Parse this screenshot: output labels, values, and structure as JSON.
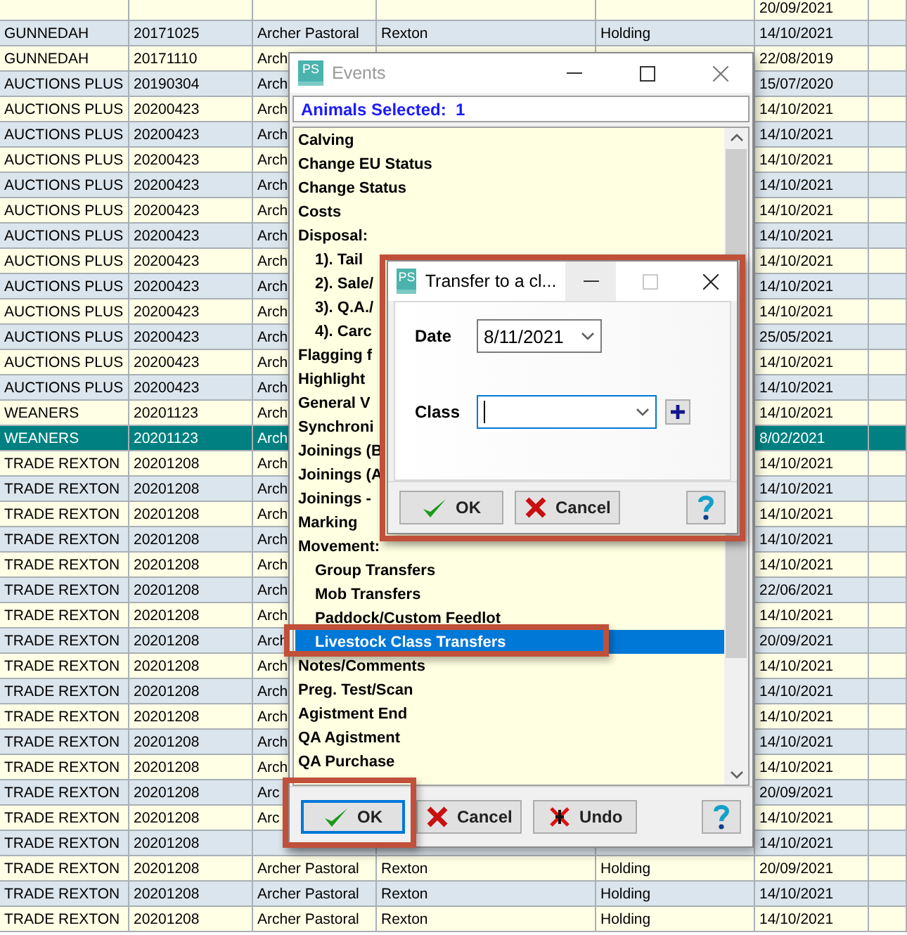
{
  "table": {
    "rows": [
      {
        "column_6": "20/09/2021",
        "selected": false
      },
      {
        "column_1": "GUNNEDAH",
        "column_2": "20171025",
        "column_3": "Archer Pastoral",
        "column_4": "Rexton",
        "column_5": "Holding",
        "column_6": "14/10/2021",
        "selected": false
      },
      {
        "column_1": "GUNNEDAH",
        "column_2": "20171110",
        "column_3": "Arch",
        "column_6": "22/08/2019",
        "selected": false
      },
      {
        "column_1": "AUCTIONS PLUS",
        "column_2": "20190304",
        "column_3": "Arch",
        "column_6": "15/07/2020",
        "selected": false
      },
      {
        "column_1": "AUCTIONS PLUS",
        "column_2": "20200423",
        "column_3": "Arch",
        "column_6": "14/10/2021",
        "selected": false
      },
      {
        "column_1": "AUCTIONS PLUS",
        "column_2": "20200423",
        "column_3": "Arch",
        "column_6": "14/10/2021",
        "selected": false
      },
      {
        "column_1": "AUCTIONS PLUS",
        "column_2": "20200423",
        "column_3": "Arch",
        "column_6": "14/10/2021",
        "selected": false
      },
      {
        "column_1": "AUCTIONS PLUS",
        "column_2": "20200423",
        "column_3": "Arch",
        "column_6": "14/10/2021",
        "selected": false
      },
      {
        "column_1": "AUCTIONS PLUS",
        "column_2": "20200423",
        "column_3": "Arch",
        "column_6": "14/10/2021",
        "selected": false
      },
      {
        "column_1": "AUCTIONS PLUS",
        "column_2": "20200423",
        "column_3": "Arch",
        "column_6": "14/10/2021",
        "selected": false
      },
      {
        "column_1": "AUCTIONS PLUS",
        "column_2": "20200423",
        "column_3": "Arch",
        "column_6": "14/10/2021",
        "selected": false
      },
      {
        "column_1": "AUCTIONS PLUS",
        "column_2": "20200423",
        "column_3": "Arch",
        "column_6": "14/10/2021",
        "selected": false
      },
      {
        "column_1": "AUCTIONS PLUS",
        "column_2": "20200423",
        "column_3": "Arch",
        "column_6": "14/10/2021",
        "selected": false
      },
      {
        "column_1": "AUCTIONS PLUS",
        "column_2": "20200423",
        "column_3": "Arch",
        "column_6": "25/05/2021",
        "selected": false
      },
      {
        "column_1": "AUCTIONS PLUS",
        "column_2": "20200423",
        "column_3": "Arch",
        "column_6": "14/10/2021",
        "selected": false
      },
      {
        "column_1": "AUCTIONS PLUS",
        "column_2": "20200423",
        "column_3": "Arch",
        "column_6": "14/10/2021",
        "selected": false
      },
      {
        "column_1": "WEANERS",
        "column_2": "20201123",
        "column_3": "Arch",
        "column_6": "14/10/2021",
        "selected": false
      },
      {
        "column_1": "WEANERS",
        "column_2": "20201123",
        "column_3": "Arch",
        "column_6": "8/02/2021",
        "selected": true
      },
      {
        "column_1": "TRADE REXTON",
        "column_2": "20201208",
        "column_3": "Arch",
        "column_6": "14/10/2021",
        "selected": false
      },
      {
        "column_1": "TRADE REXTON",
        "column_2": "20201208",
        "column_3": "Arch",
        "column_6": "14/10/2021",
        "selected": false
      },
      {
        "column_1": "TRADE REXTON",
        "column_2": "20201208",
        "column_3": "Arch",
        "column_6": "14/10/2021",
        "selected": false
      },
      {
        "column_1": "TRADE REXTON",
        "column_2": "20201208",
        "column_3": "Arch",
        "column_6": "14/10/2021",
        "selected": false
      },
      {
        "column_1": "TRADE REXTON",
        "column_2": "20201208",
        "column_3": "Arch",
        "column_6": "14/10/2021",
        "selected": false
      },
      {
        "column_1": "TRADE REXTON",
        "column_2": "20201208",
        "column_3": "Arch",
        "column_6": "22/06/2021",
        "selected": false
      },
      {
        "column_1": "TRADE REXTON",
        "column_2": "20201208",
        "column_3": "Arch",
        "column_6": "14/10/2021",
        "selected": false
      },
      {
        "column_1": "TRADE REXTON",
        "column_2": "20201208",
        "column_3": "Arch",
        "column_6": "20/09/2021",
        "selected": false
      },
      {
        "column_1": "TRADE REXTON",
        "column_2": "20201208",
        "column_3": "Arch",
        "column_6": "14/10/2021",
        "selected": false
      },
      {
        "column_1": "TRADE REXTON",
        "column_2": "20201208",
        "column_3": "Arch",
        "column_6": "14/10/2021",
        "selected": false
      },
      {
        "column_1": "TRADE REXTON",
        "column_2": "20201208",
        "column_3": "Arch",
        "column_6": "14/10/2021",
        "selected": false
      },
      {
        "column_1": "TRADE REXTON",
        "column_2": "20201208",
        "column_3": "Arch",
        "column_6": "14/10/2021",
        "selected": false
      },
      {
        "column_1": "TRADE REXTON",
        "column_2": "20201208",
        "column_3": "Arch",
        "column_6": "14/10/2021",
        "selected": false
      },
      {
        "column_1": "TRADE REXTON",
        "column_2": "20201208",
        "column_3": "Arc",
        "column_6": "20/09/2021",
        "selected": false
      },
      {
        "column_1": "TRADE REXTON",
        "column_2": "20201208",
        "column_3": "Arc",
        "column_6": "14/10/2021",
        "selected": false
      },
      {
        "column_1": "TRADE REXTON",
        "column_2": "20201208",
        "column_6": "14/10/2021",
        "selected": false
      },
      {
        "column_1": "TRADE REXTON",
        "column_2": "20201208",
        "column_3": "Archer Pastoral",
        "column_4": "Rexton",
        "column_5": "Holding",
        "column_6": "20/09/2021",
        "selected": false
      },
      {
        "column_1": "TRADE REXTON",
        "column_2": "20201208",
        "column_3": "Archer Pastoral",
        "column_4": "Rexton",
        "column_5": "Holding",
        "column_6": "14/10/2021",
        "selected": false
      },
      {
        "column_1": "TRADE REXTON",
        "column_2": "20201208",
        "column_3": "Archer Pastoral",
        "column_4": "Rexton",
        "column_5": "Holding",
        "column_6": "14/10/2021",
        "selected": false
      }
    ]
  },
  "events_dialog": {
    "logo_text": "PS",
    "title": "Events",
    "active": false,
    "maximize_enabled": true,
    "animals_selected": "Animals Selected:  1",
    "items": [
      {
        "label": "Calving",
        "indented": false,
        "selected": false
      },
      {
        "label": "Change EU Status",
        "indented": false,
        "selected": false
      },
      {
        "label": "Change Status",
        "indented": false,
        "selected": false
      },
      {
        "label": "Costs",
        "indented": false,
        "selected": false
      },
      {
        "label": "Disposal:",
        "indented": false,
        "selected": false
      },
      {
        "label": "1). Tail",
        "indented": true,
        "selected": false
      },
      {
        "label": "2). Sale/",
        "indented": true,
        "selected": false
      },
      {
        "label": "3). Q.A./",
        "indented": true,
        "selected": false
      },
      {
        "label": "4). Carc",
        "indented": true,
        "selected": false
      },
      {
        "label": "Flagging f",
        "indented": false,
        "selected": false
      },
      {
        "label": "Highlight",
        "indented": false,
        "selected": false
      },
      {
        "label": "General V",
        "indented": false,
        "selected": false
      },
      {
        "label": "Synchroni",
        "indented": false,
        "selected": false
      },
      {
        "label": "Joinings (B",
        "indented": false,
        "selected": false
      },
      {
        "label": "Joinings (A",
        "indented": false,
        "selected": false
      },
      {
        "label": "Joinings -",
        "indented": false,
        "selected": false
      },
      {
        "label": "Marking",
        "indented": false,
        "selected": false
      },
      {
        "label": "Movement:",
        "indented": false,
        "selected": false
      },
      {
        "label": "Group Transfers",
        "indented": true,
        "selected": false
      },
      {
        "label": "Mob Transfers",
        "indented": true,
        "selected": false
      },
      {
        "label": "Paddock/Custom Feedlot",
        "indented": true,
        "selected": false
      },
      {
        "label": "Livestock Class Transfers",
        "indented": true,
        "selected": true
      },
      {
        "label": "Notes/Comments",
        "indented": false,
        "selected": false
      },
      {
        "label": "Preg. Test/Scan",
        "indented": false,
        "selected": false
      },
      {
        "label": "Agistment End",
        "indented": false,
        "selected": false
      },
      {
        "label": "QA Agistment",
        "indented": false,
        "selected": false
      },
      {
        "label": "QA Purchase",
        "indented": false,
        "selected": false
      }
    ],
    "buttons": [
      {
        "kind": "ok",
        "label": "OK",
        "focused": true
      },
      {
        "kind": "cancel",
        "label": "Cancel",
        "focused": false
      },
      {
        "kind": "undo",
        "label": "Undo",
        "focused": false
      },
      {
        "kind": "help",
        "focused": false
      }
    ]
  },
  "transfer_dialog": {
    "logo_text": "PS",
    "title": "Transfer to a cl...",
    "active": true,
    "maximize_enabled": false,
    "fields": [
      {
        "label": "Date",
        "value": "8/11/2021",
        "focused": false
      },
      {
        "label": "Class",
        "focused": true
      }
    ],
    "buttons": [
      {
        "kind": "ok",
        "label": "OK",
        "focused": false
      },
      {
        "kind": "cancel",
        "label": "Cancel",
        "focused": false
      },
      {
        "kind": "help",
        "focused": false
      }
    ]
  }
}
